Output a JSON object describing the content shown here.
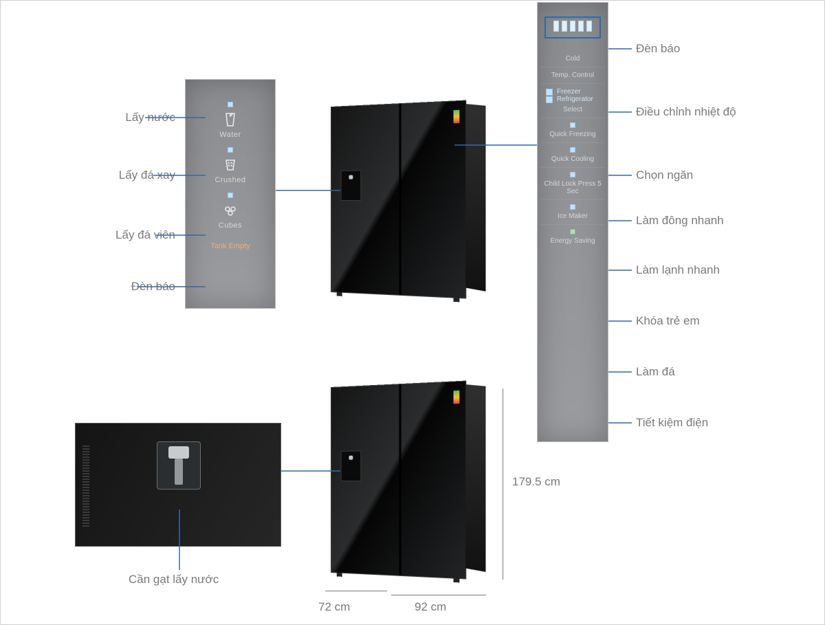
{
  "left_panel": {
    "buttons": [
      {
        "id": "water",
        "label": "Water",
        "callout": "Lấy nước"
      },
      {
        "id": "crushed",
        "label": "Crushed",
        "callout": "Lấy đá xay"
      },
      {
        "id": "cubes",
        "label": "Cubes",
        "callout": "Lấy đá viên"
      }
    ],
    "indicator": {
      "label": "Tank Empty",
      "callout": "Đèn báo"
    }
  },
  "right_panel": {
    "items": [
      {
        "id": "indicator",
        "label": "Cold",
        "note": "",
        "callout": "Đèn báo"
      },
      {
        "id": "tempctrl",
        "label": "Temp. Control",
        "callout": "Điều chỉnh nhiệt độ"
      },
      {
        "id": "select",
        "label": "Select",
        "opt1": "Freezer",
        "opt2": "Refrigerator",
        "callout": "Chọn ngăn"
      },
      {
        "id": "qfreeze",
        "label": "Quick Freezing",
        "callout": "Làm đông nhanh"
      },
      {
        "id": "qcool",
        "label": "Quick Cooling",
        "callout": "Làm lạnh nhanh"
      },
      {
        "id": "childlock",
        "label": "Child Lock Press 5 Sec",
        "callout": "Khóa trẻ em"
      },
      {
        "id": "icemaker",
        "label": "Ice Maker",
        "callout": "Làm đá"
      },
      {
        "id": "energysav",
        "label": "Energy Saving",
        "callout": "Tiết kiệm điện"
      }
    ]
  },
  "dimensions": {
    "height": "179.5 cm",
    "width": "92 cm",
    "depth": "72 cm"
  },
  "lever_caption": "Cần gạt lấy nước"
}
